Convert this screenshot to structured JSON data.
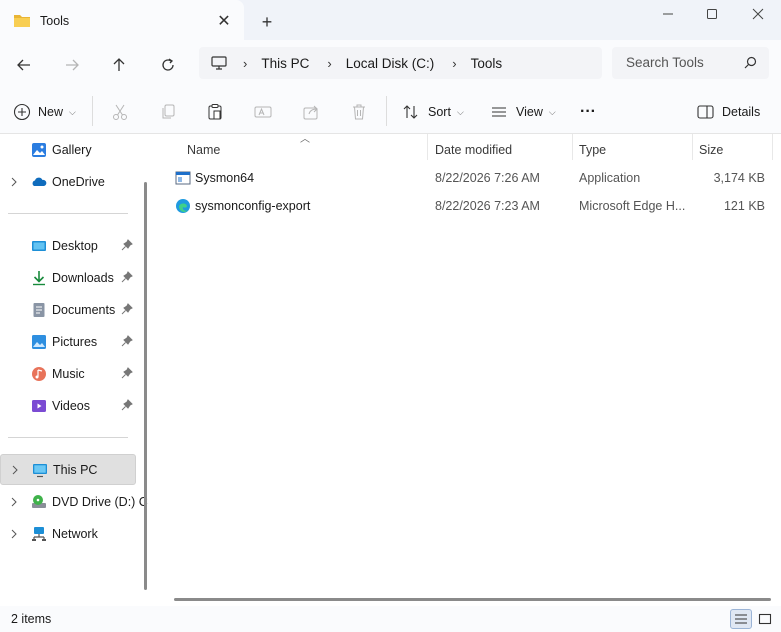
{
  "window": {
    "tab_title": "Tools",
    "new_tab_symbol": "+",
    "close_tab_symbol": "✕"
  },
  "address": {
    "crumbs": [
      "This PC",
      "Local Disk (C:)",
      "Tools"
    ]
  },
  "search": {
    "placeholder": "Search Tools"
  },
  "toolbar": {
    "new_label": "New",
    "sort_label": "Sort",
    "view_label": "View",
    "more_label": "···",
    "details_label": "Details"
  },
  "sidebar": {
    "items": [
      {
        "label": "Gallery",
        "icon": "gallery-icon"
      },
      {
        "label": "OneDrive",
        "icon": "onedrive-icon"
      },
      {
        "label": "Desktop",
        "icon": "desktop-icon"
      },
      {
        "label": "Downloads",
        "icon": "downloads-icon"
      },
      {
        "label": "Documents",
        "icon": "documents-icon"
      },
      {
        "label": "Pictures",
        "icon": "pictures-icon"
      },
      {
        "label": "Music",
        "icon": "music-icon"
      },
      {
        "label": "Videos",
        "icon": "videos-icon"
      },
      {
        "label": "This PC",
        "icon": "this-pc-icon"
      },
      {
        "label": "DVD Drive (D:) C",
        "icon": "dvd-drive-icon"
      },
      {
        "label": "Network",
        "icon": "network-icon"
      }
    ]
  },
  "table": {
    "columns": [
      "Name",
      "Date modified",
      "Type",
      "Size"
    ],
    "rows": [
      {
        "name": "Sysmon64",
        "date": "8/22/2026 7:26 AM",
        "type": "Application",
        "size": "3,174 KB"
      },
      {
        "name": "sysmonconfig-export",
        "date": "8/22/2026 7:23 AM",
        "type": "Microsoft Edge H...",
        "size": "121 KB"
      }
    ]
  },
  "status": {
    "item_count": "2 items"
  },
  "colors": {
    "folder": "#f4c242",
    "accent": "#0067c0",
    "selected_bg": "#e0e0e0"
  }
}
